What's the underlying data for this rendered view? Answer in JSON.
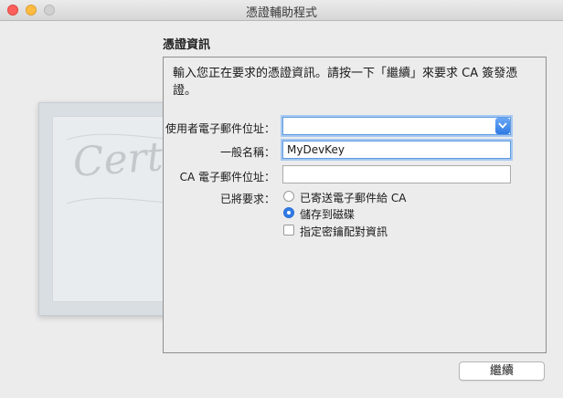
{
  "window": {
    "title": "憑證輔助程式"
  },
  "section_title": "憑證資訊",
  "intro": "輸入您正在要求的憑證資訊。請按一下「繼續」來要求 CA 簽發憑證。",
  "form": {
    "user_email_label": "使用者電子郵件位址：",
    "user_email_value": "",
    "common_name_label": "一般名稱：",
    "common_name_value": "MyDevKey",
    "ca_email_label": "CA 電子郵件位址：",
    "ca_email_value": "",
    "request_label": "已將要求：",
    "option_email_ca": "已寄送電子郵件給 CA",
    "option_save_disk": "儲存到磁碟",
    "option_key_pair": "指定密鑰配對資訊",
    "selected_option": "儲存到磁碟",
    "key_pair_checked": false
  },
  "buttons": {
    "continue": "繼續"
  },
  "background_art": {
    "certificate_text": "Certificate"
  },
  "colors": {
    "accent": "#2f7ae5",
    "focus_ring": "#a6c8f2"
  }
}
